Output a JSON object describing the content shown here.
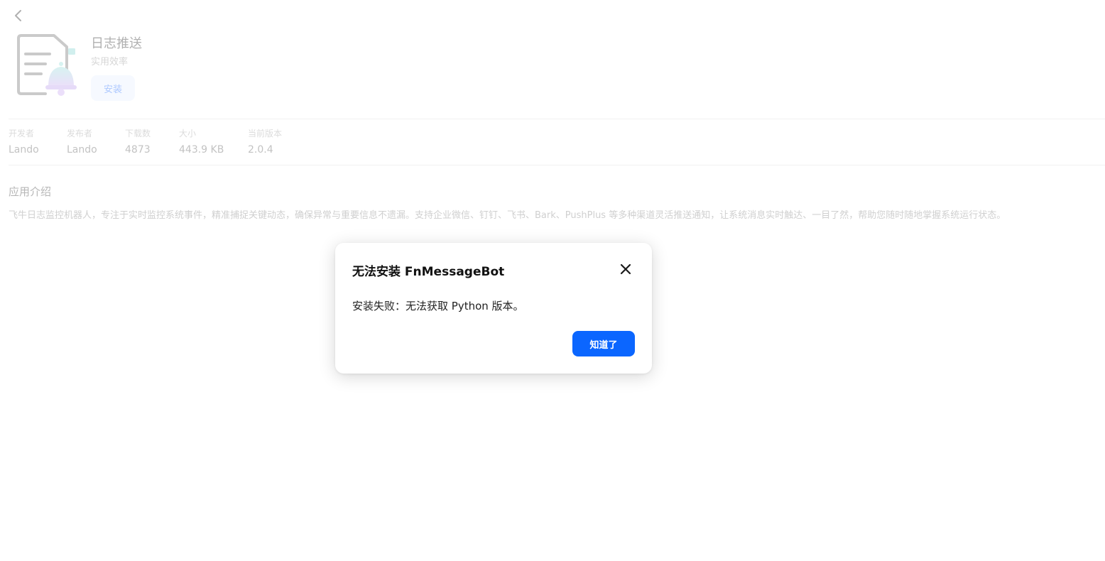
{
  "app": {
    "name": "日志推送",
    "category": "实用效率",
    "install_label": "安装"
  },
  "meta": [
    {
      "label": "开发者",
      "value": "Lando"
    },
    {
      "label": "发布者",
      "value": "Lando"
    },
    {
      "label": "下载数",
      "value": "4873"
    },
    {
      "label": "大小",
      "value": "443.9 KB"
    },
    {
      "label": "当前版本",
      "value": "2.0.4"
    }
  ],
  "intro": {
    "title": "应用介绍",
    "text": "飞牛日志监控机器人，专注于实时监控系统事件，精准捕捉关键动态，确保异常与重要信息不遗漏。支持企业微信、钉钉、飞书、Bark、PushPlus 等多种渠道灵活推送通知，让系统消息实时触达、一目了然，帮助您随时随地掌握系统运行状态。"
  },
  "dialog": {
    "title": "无法安装 FnMessageBot",
    "message": "安装失败：无法获取 Python 版本。",
    "ok_label": "知道了"
  },
  "icons": {
    "back": "chevron-left-icon",
    "close": "close-icon",
    "app": "log-bell-icon"
  },
  "colors": {
    "accent": "#0b66ff",
    "install_bg": "#e6efff",
    "bell_top": "#9fdde0",
    "bell_bottom": "#c9a7ef"
  }
}
